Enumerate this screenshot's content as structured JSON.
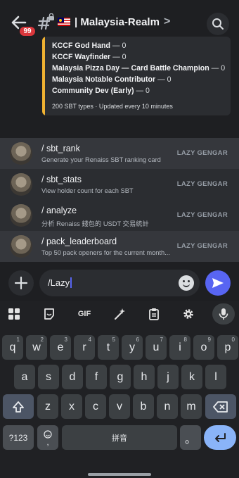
{
  "header": {
    "notification_count": "99",
    "channel_name": "| Malaysia-Realm",
    "chevron": ">"
  },
  "embed": {
    "lines": [
      {
        "bold": "KCCF God Hand",
        "rest": " — 0"
      },
      {
        "bold": "KCCF Wayfinder",
        "rest": " — 0"
      },
      {
        "bold": "Malaysia Pizza Day — Card Battle Champion",
        "rest": " — 0"
      },
      {
        "bold": "Malaysia Notable Contributor",
        "rest": " — 0"
      },
      {
        "bold": "Community Dev (Early)",
        "rest": " — 0"
      }
    ],
    "footer": "200 SBT types · Updated every 10 minutes",
    "accent_color": "#f0b232"
  },
  "commands": [
    {
      "name": "/ sbt_rank",
      "description": "Generate your Renaiss SBT ranking card",
      "app": "LAZY GENGAR"
    },
    {
      "name": "/ sbt_stats",
      "description": "View holder count for each SBT",
      "app": "LAZY GENGAR"
    },
    {
      "name": "/ analyze",
      "description": "分析 Renaiss 錢包的 USDT 交易統計",
      "app": "LAZY GENGAR"
    },
    {
      "name": "/ pack_leaderboard",
      "description": "Top 50 pack openers for the current month...",
      "app": "LAZY GENGAR"
    }
  ],
  "input": {
    "value": "/Lazy"
  },
  "keyboard": {
    "toolbar": [
      "apps-grid-icon",
      "sticker-icon",
      "GIF",
      "magic-edit-icon",
      "clipboard-icon",
      "gear-icon",
      "mic-icon"
    ],
    "row1": [
      {
        "k": "q",
        "n": "1"
      },
      {
        "k": "w",
        "n": "2"
      },
      {
        "k": "e",
        "n": "3"
      },
      {
        "k": "r",
        "n": "4"
      },
      {
        "k": "t",
        "n": "5"
      },
      {
        "k": "y",
        "n": "6"
      },
      {
        "k": "u",
        "n": "7"
      },
      {
        "k": "i",
        "n": "8"
      },
      {
        "k": "o",
        "n": "9"
      },
      {
        "k": "p",
        "n": "0"
      }
    ],
    "row2": [
      "a",
      "s",
      "d",
      "f",
      "g",
      "h",
      "j",
      "k",
      "l"
    ],
    "row3": [
      "z",
      "x",
      "c",
      "v",
      "b",
      "n",
      "m"
    ],
    "symbols_label": "?123",
    "comma": ",",
    "space_label": "拼音",
    "period": "。"
  },
  "colors": {
    "background": "#1e1f22",
    "panel": "#2b2d31",
    "accent": "#5865f2",
    "badge": "#da373c"
  }
}
